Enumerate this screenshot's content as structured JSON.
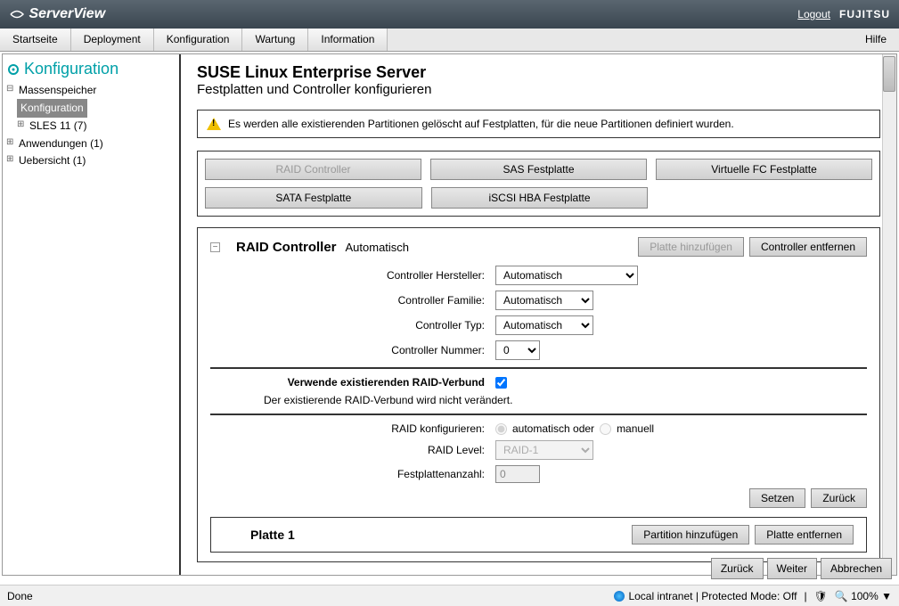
{
  "topbar": {
    "product": "ServerView",
    "logout": "Logout",
    "vendor": "FUJITSU"
  },
  "menu": {
    "items": [
      "Startseite",
      "Deployment",
      "Konfiguration",
      "Wartung",
      "Information"
    ],
    "help": "Hilfe"
  },
  "sidebar": {
    "title": "Konfiguration",
    "nodes": {
      "root": "Massenspeicher",
      "selected": "Konfiguration",
      "sles": "SLES 11 (7)",
      "apps": "Anwendungen (1)",
      "overview": "Uebersicht (1)"
    }
  },
  "main": {
    "title": "SUSE Linux Enterprise Server",
    "subtitle": "Festplatten und Controller konfigurieren",
    "warning": "Es werden alle existierenden Partitionen gelöscht auf Festplatten, für die neue Partitionen definiert wurden.",
    "buttons": {
      "raid": "RAID Controller",
      "sas": "SAS Festplatte",
      "vfc": "Virtuelle FC Festplatte",
      "sata": "SATA Festplatte",
      "iscsi": "iSCSI HBA Festplatte"
    },
    "raid_panel": {
      "title": "RAID Controller",
      "mode": "Automatisch",
      "add_disk": "Platte hinzufügen",
      "remove_ctrl": "Controller entfernen",
      "fields": {
        "vendor_label": "Controller Hersteller:",
        "vendor_value": "Automatisch",
        "family_label": "Controller Familie:",
        "family_value": "Automatisch",
        "type_label": "Controller Typ:",
        "type_value": "Automatisch",
        "number_label": "Controller Nummer:",
        "number_value": "0"
      },
      "existing_raid_label": "Verwende existierenden RAID-Verbund",
      "existing_raid_checked": true,
      "existing_raid_note": "Der existierende RAID-Verbund wird nicht verändert.",
      "configure_label": "RAID konfigurieren:",
      "radio_auto": "automatisch oder",
      "radio_manual": "manuell",
      "level_label": "RAID Level:",
      "level_value": "RAID-1",
      "diskcount_label": "Festplattenanzahl:",
      "diskcount_value": "0",
      "set": "Setzen",
      "reset": "Zurück"
    },
    "plate": {
      "title": "Platte 1",
      "add_partition": "Partition hinzufügen",
      "remove": "Platte entfernen"
    }
  },
  "footer": {
    "back": "Zurück",
    "next": "Weiter",
    "cancel": "Abbrechen"
  },
  "status": {
    "done": "Done",
    "zone": "Local intranet | Protected Mode: Off",
    "zoom": "100%"
  }
}
